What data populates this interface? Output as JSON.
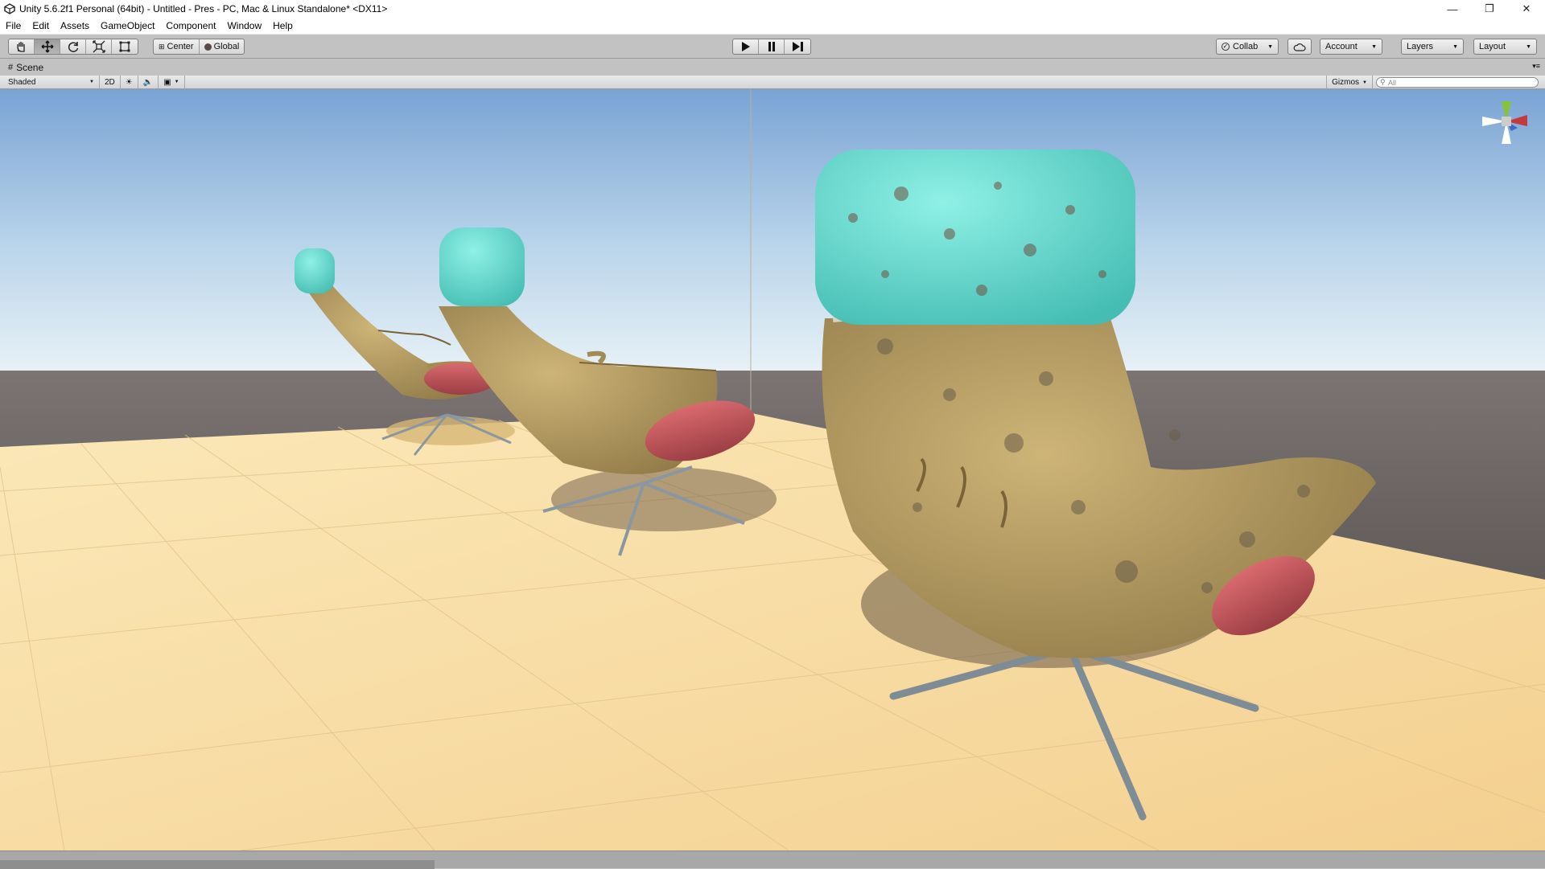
{
  "window": {
    "title": "Unity 5.6.2f1 Personal (64bit) - Untitled - Pres - PC, Mac & Linux Standalone* <DX11>",
    "controls": {
      "minimize": "—",
      "maximize": "❐",
      "close": "✕"
    }
  },
  "menu": {
    "items": [
      {
        "label": "File"
      },
      {
        "label": "Edit"
      },
      {
        "label": "Assets"
      },
      {
        "label": "GameObject"
      },
      {
        "label": "Component"
      },
      {
        "label": "Window"
      },
      {
        "label": "Help"
      }
    ]
  },
  "toolbar": {
    "transform_tools": [
      "hand-icon",
      "move-icon",
      "rotate-icon",
      "scale-icon",
      "rect-icon"
    ],
    "active_tool": "move-icon",
    "pivot_mode": "Center",
    "pivot_rotation": "Global",
    "play_controls": [
      "play-icon",
      "pause-icon",
      "step-icon"
    ],
    "collab_label": "Collab",
    "account_label": "Account",
    "layers_label": "Layers",
    "layout_label": "Layout"
  },
  "scene": {
    "tab_label": "Scene",
    "draw_mode": "Shaded",
    "mode_2d": "2D",
    "gizmos_label": "Gizmos",
    "search_placeholder": "All"
  },
  "colors": {
    "editor_gray": "#c2c2c2",
    "sky_top": "#7da6d6",
    "horizon": "#dcecf5",
    "ground_far": "#4a4645",
    "floor": "#f5d69a",
    "chair_shell": "#b49a5c",
    "headrest": "#68d8cf",
    "cushion": "#c4545a",
    "legs": "#8c9aa8"
  }
}
